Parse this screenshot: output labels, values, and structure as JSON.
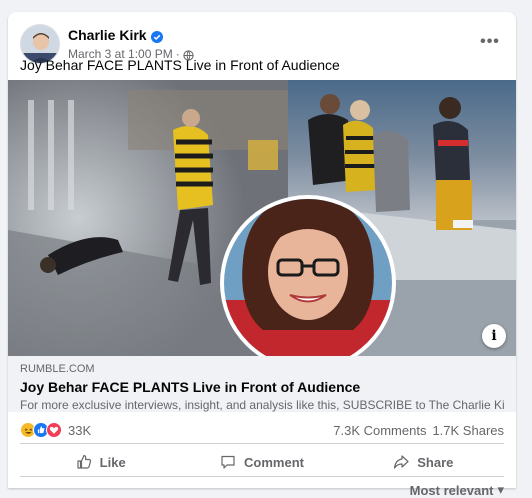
{
  "post": {
    "author": "Charlie Kirk",
    "timestamp": "March 3 at 1:00 PM",
    "separator": "·",
    "caption": "Joy Behar FACE PLANTS Live in Front of Audience",
    "more_label": "•••"
  },
  "link": {
    "domain": "RUMBLE.COM",
    "title": "Joy Behar FACE PLANTS Live in Front of Audience",
    "description": "For more exclusive interviews, insight, and analysis like this, SUBSCRIBE to The Charlie Kirk Show TOD...",
    "info_label": "i"
  },
  "stats": {
    "reaction_count": "33K",
    "comments": "7.3K Comments",
    "shares": "1.7K Shares"
  },
  "actions": {
    "like": "Like",
    "comment": "Comment",
    "share": "Share"
  },
  "sort": {
    "label": "Most relevant",
    "caret": "▾"
  },
  "colors": {
    "accent_blue": "#1877f2",
    "haha_yellow": "#f7b928",
    "love_red": "#f33e58"
  }
}
